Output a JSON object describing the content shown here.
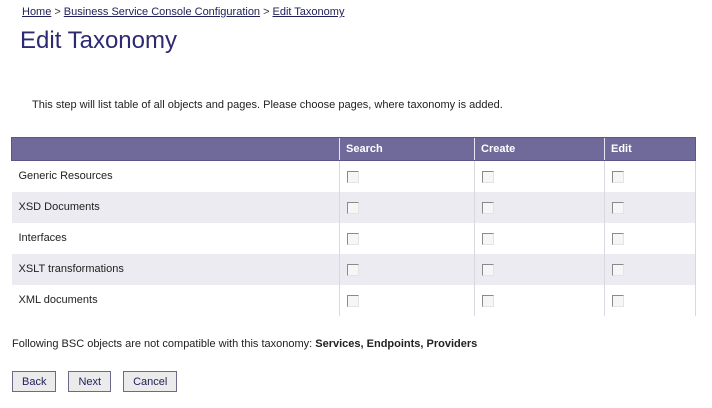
{
  "breadcrumb": {
    "items": [
      "Home",
      "Business Service Console Configuration",
      "Edit Taxonomy"
    ],
    "separator": ">"
  },
  "page_title": "Edit Taxonomy",
  "intro": "This step will list table of all objects and pages. Please choose pages, where taxonomy is added.",
  "table": {
    "columns": [
      "",
      "Search",
      "Create",
      "Edit"
    ],
    "rows": [
      {
        "label": "Generic Resources",
        "search": false,
        "create": false,
        "edit": false
      },
      {
        "label": "XSD Documents",
        "search": false,
        "create": false,
        "edit": false
      },
      {
        "label": "Interfaces",
        "search": false,
        "create": false,
        "edit": false
      },
      {
        "label": "XSLT transformations",
        "search": false,
        "create": false,
        "edit": false
      },
      {
        "label": "XML documents",
        "search": false,
        "create": false,
        "edit": false
      }
    ]
  },
  "note": {
    "prefix": "Following BSC objects are not compatible with this taxonomy:",
    "items": "Services, Endpoints, Providers"
  },
  "buttons": {
    "back": "Back",
    "next": "Next",
    "cancel": "Cancel"
  },
  "colors": {
    "header_bg": "#6f6a9a",
    "title": "#2e2a72",
    "alt_row": "#ebebf1"
  }
}
